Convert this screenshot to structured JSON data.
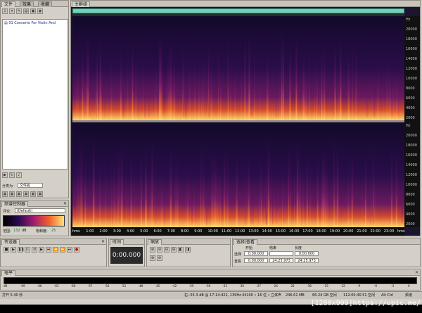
{
  "files_panel": {
    "tabs": [
      "文件",
      "效果",
      "收藏"
    ],
    "file_name": "01 Concerto For Violin And",
    "sort_label": "分类为:",
    "sort_value": "文件名"
  },
  "freq_panel": {
    "title": "频谱控制器",
    "mode_label": "评论:",
    "mode_value": "(Default)",
    "range_label": "范围:",
    "range_value": "132",
    "range_unit": "dB",
    "sat_label": "饱和度:",
    "sat_value": "25"
  },
  "main_tab": "主群组",
  "time_ruler": [
    "hms",
    "1:00",
    "2:00",
    "3:00",
    "4:00",
    "5:00",
    "6:00",
    "7:00",
    "8:00",
    "9:00",
    "10:00",
    "11:00",
    "12:00",
    "13:00",
    "14:00",
    "15:00",
    "16:00",
    "17:00",
    "18:00",
    "19:00",
    "20:00",
    "21:00",
    "22:00",
    "23:00",
    "hms"
  ],
  "freq_ruler": [
    "Hz",
    "20000",
    "18000",
    "16000",
    "14000",
    "12000",
    "10000",
    "8000",
    "6000",
    "4000",
    "2000"
  ],
  "transport": {
    "title": "传送器"
  },
  "time_panel": {
    "title": "时间",
    "value": "0:00.000"
  },
  "zoom_panel": {
    "title": "缩放"
  },
  "selection_panel": {
    "title": "选择/查看",
    "col_start": "开始",
    "col_end": "结束",
    "col_len": "长度",
    "row_sel": "选择",
    "row_view": "查看",
    "sel_start": "0:00.000",
    "sel_end": "",
    "sel_len": "0:00.000",
    "view_start": "0:00.000",
    "view_end": "24:25.973",
    "view_len": "24:25.973"
  },
  "level_panel": {
    "title": "电平"
  },
  "level_ruler": [
    "dB",
    "-69",
    "-66",
    "-63",
    "-60",
    "-57",
    "-54",
    "-51",
    "-48",
    "-45",
    "-42",
    "-39",
    "-36",
    "-33",
    "-30",
    "-27",
    "-24",
    "-21",
    "-18",
    "-15",
    "-12",
    "-9",
    "-6",
    "-3",
    "0"
  ],
  "status": {
    "open_time": "打开 5.40 秒",
    "cursor": "右:-55.3 dB @ 17:14:422, 139Hz",
    "format": "44100 • 16 位 • 立体声",
    "size": "246.61 MB",
    "free": "66.24 GB 空间",
    "free_time": "112:00:40.51 空闲",
    "alt": "Alt Ctrl",
    "mode": "频谱"
  },
  "watermark": "[1280x909]https://upic.me/",
  "colors": {
    "accent": "#6fd4b8",
    "spectrogram_low": "#1a0a3a",
    "spectrogram_high": "#ffd36b"
  }
}
